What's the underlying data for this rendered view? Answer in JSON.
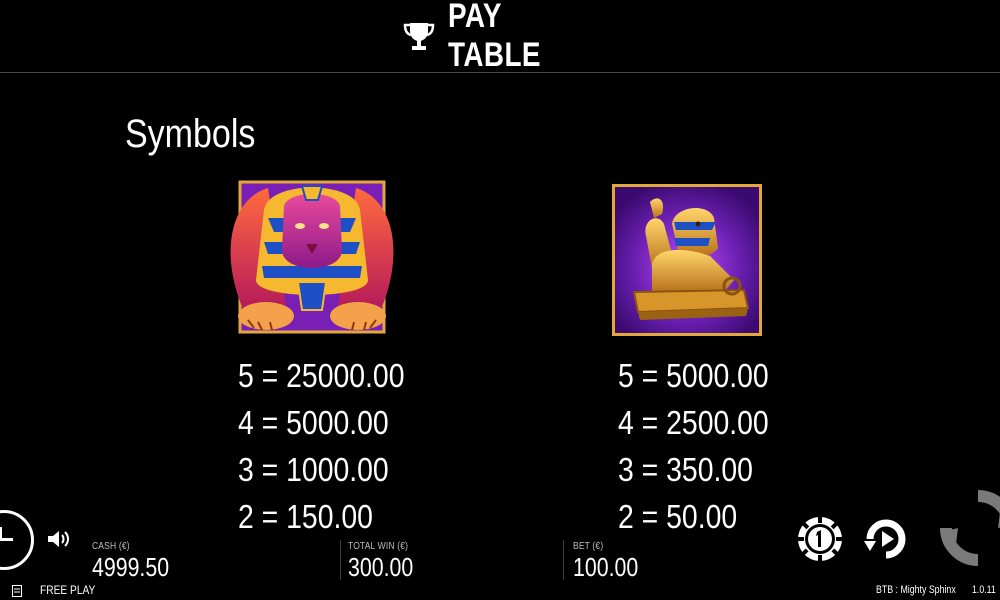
{
  "header": {
    "title": "PAY TABLE",
    "icon": "trophy-icon"
  },
  "section": {
    "title": "Symbols"
  },
  "symbols": [
    {
      "name": "winged-sphinx",
      "payouts": [
        "5 = 25000.00",
        "4 = 5000.00",
        "3 = 1000.00",
        "2 = 150.00"
      ]
    },
    {
      "name": "golden-sphinx-statue",
      "payouts": [
        "5 = 5000.00",
        "4 = 2500.00",
        "3 = 350.00",
        "2 = 50.00"
      ]
    }
  ],
  "footer": {
    "cash_label": "CASH (€)",
    "cash_value": "4999.50",
    "total_win_label": "TOTAL WIN (€)",
    "total_win_value": "300.00",
    "bet_label": "BET (€)",
    "bet_value": "100.00",
    "mode": "FREE PLAY",
    "game": "BTB : Mighty Sphinx",
    "version": "1.0.11"
  },
  "colors": {
    "background": "#000000",
    "text": "#ffffff",
    "label": "#bdbdbd",
    "frame_gold": "#e2a93a",
    "card_purple": "#6a1fb0",
    "sphinx_red": "#c2185b",
    "sphinx_gold": "#f5b82e",
    "stripe_blue": "#1e4fc4"
  }
}
